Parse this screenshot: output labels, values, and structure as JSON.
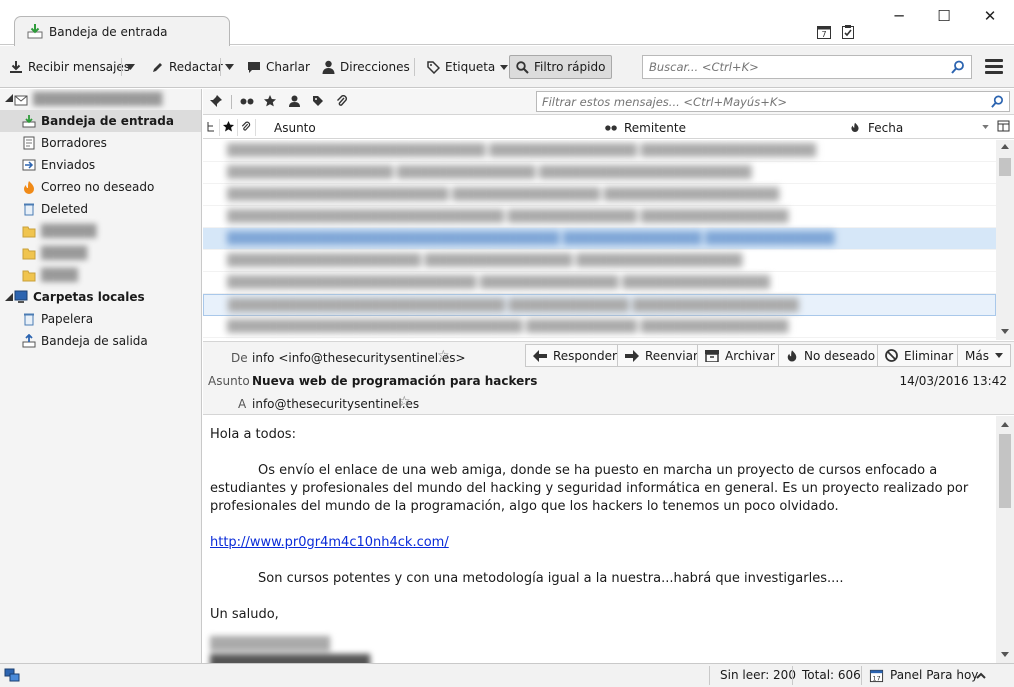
{
  "tab": {
    "title": "Bandeja de entrada"
  },
  "window": {
    "minimize": "─",
    "maximize": "☐",
    "close": "✕"
  },
  "toolbar": {
    "get_mail": "Recibir mensajes",
    "write": "Redactar",
    "chat": "Charlar",
    "address_book": "Direcciones",
    "tag": "Etiqueta",
    "quick_filter": "Filtro rápido",
    "search_placeholder": "Buscar... <Ctrl+K>"
  },
  "folders": {
    "inbox": "Bandeja de entrada",
    "drafts": "Borradores",
    "sent": "Enviados",
    "junk": "Correo no deseado",
    "deleted": "Deleted",
    "local_folders": "Carpetas locales",
    "trash": "Papelera",
    "outbox": "Bandeja de salida"
  },
  "quick_filter": {
    "placeholder": "Filtrar estos mensajes... <Ctrl+Mayús+K>"
  },
  "columns": {
    "subject": "Asunto",
    "sender": "Remitente",
    "date": "Fecha"
  },
  "message": {
    "from_label": "De",
    "from": "info <info@thesecuritysentinel.es>",
    "subject_label": "Asunto",
    "subject": "Nueva web de programación para hackers",
    "date": "14/03/2016 13:42",
    "to_label": "A",
    "to": "info@thesecuritysentinel.es",
    "actions": {
      "reply": "Responder",
      "forward": "Reenviar",
      "archive": "Archivar",
      "not_junk": "No deseado",
      "delete": "Eliminar",
      "more": "Más"
    },
    "body": {
      "greeting": "Hola a todos:",
      "paragraph1": "Os envío el enlace de una web amiga, donde se ha puesto en marcha un proyecto de cursos enfocado a estudiantes y profesionales del mundo  del hacking y seguridad informática en general. Es un proyecto realizado por profesionales del mundo de la programación, algo que los hackers lo tenemos un poco olvidado.",
      "link": "http://www.pr0gr4m4c10nh4ck.com/",
      "paragraph2": "Son cursos potentes y con una metodología igual a la nuestra...habrá que investigarles....",
      "closing": "Un saludo,"
    }
  },
  "status": {
    "unread": "Sin leer: 200",
    "total": "Total: 606",
    "today_pane": "Panel Para hoy"
  }
}
